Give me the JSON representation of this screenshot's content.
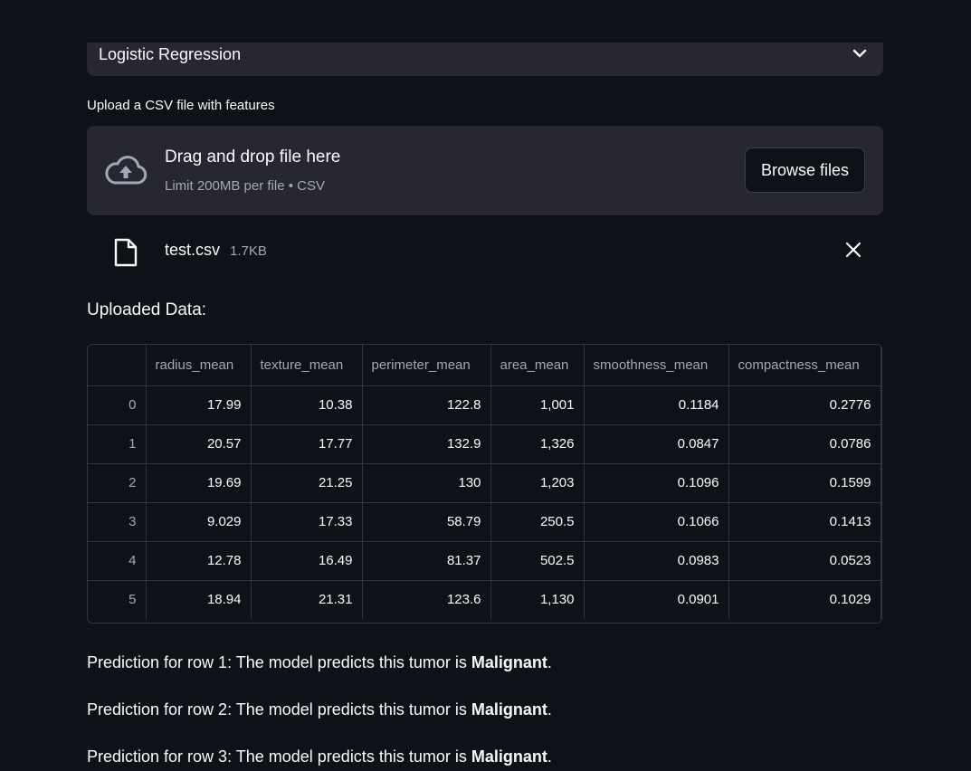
{
  "model_select": {
    "value": "Logistic Regression"
  },
  "uploader": {
    "label": "Upload a CSV file with features",
    "drop_title": "Drag and drop file here",
    "drop_subtitle": "Limit 200MB per file • CSV",
    "browse_label": "Browse files",
    "file_name": "test.csv",
    "file_size": "1.7KB"
  },
  "section_title": "Uploaded Data:",
  "table": {
    "columns": [
      "radius_mean",
      "texture_mean",
      "perimeter_mean",
      "area_mean",
      "smoothness_mean",
      "compactness_mean"
    ],
    "rows": [
      [
        "0",
        "17.99",
        "10.38",
        "122.8",
        "1,001",
        "0.1184",
        "0.2776"
      ],
      [
        "1",
        "20.57",
        "17.77",
        "132.9",
        "1,326",
        "0.0847",
        "0.0786"
      ],
      [
        "2",
        "19.69",
        "21.25",
        "130",
        "1,203",
        "0.1096",
        "0.1599"
      ],
      [
        "3",
        "9.029",
        "17.33",
        "58.79",
        "250.5",
        "0.1066",
        "0.1413"
      ],
      [
        "4",
        "12.78",
        "16.49",
        "81.37",
        "502.5",
        "0.0983",
        "0.0523"
      ],
      [
        "5",
        "18.94",
        "21.31",
        "123.6",
        "1,130",
        "0.0901",
        "0.1029"
      ]
    ]
  },
  "predictions": [
    {
      "prefix": "Prediction for row 1: The model predicts this tumor is ",
      "result": "Malignant",
      "suffix": "."
    },
    {
      "prefix": "Prediction for row 2: The model predicts this tumor is ",
      "result": "Malignant",
      "suffix": "."
    },
    {
      "prefix": "Prediction for row 3: The model predicts this tumor is ",
      "result": "Malignant",
      "suffix": "."
    }
  ],
  "colors": {
    "background": "#0e1117",
    "panel": "#262730",
    "border": "#31333f",
    "muted_text": "#a3a8b8"
  }
}
